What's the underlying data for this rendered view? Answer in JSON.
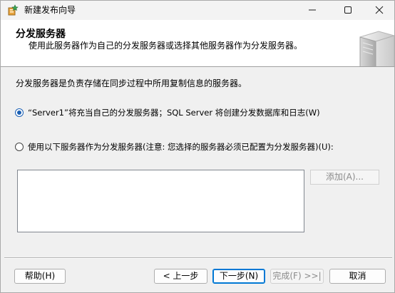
{
  "window": {
    "title": "新建发布向导",
    "icons": {
      "app": "wizard-app-icon",
      "minimize": "minimize-icon",
      "maximize": "maximize-icon",
      "close": "close-icon"
    }
  },
  "header": {
    "title": "分发服务器",
    "subtitle": "使用此服务器作为自己的分发服务器或选择其他服务器作为分发服务器。",
    "graphic": "server-graphic"
  },
  "body": {
    "description": "分发服务器是负责存储在同步过程中所用复制信息的服务器。",
    "options": [
      {
        "label": "“Server1”将充当自己的分发服务器；SQL Server 将创建分发数据库和日志(W)",
        "selected": true
      },
      {
        "label": "使用以下服务器作为分发服务器(注意: 您选择的服务器必须已配置为分发服务器)(U):",
        "selected": false
      }
    ],
    "server_list": {
      "items": []
    },
    "add_button": "添加(A)..."
  },
  "footer": {
    "help": "帮助(H)",
    "back": "< 上一步",
    "next": "下一步(N)",
    "finish": "完成(F) >>|",
    "cancel": "取消"
  },
  "colors": {
    "accent": "#0078d4",
    "radio_selected": "#1a5fb4",
    "disabled_text": "#8a8a8a",
    "dialog_background": "#f0f0f0",
    "header_background": "#ffffff"
  }
}
